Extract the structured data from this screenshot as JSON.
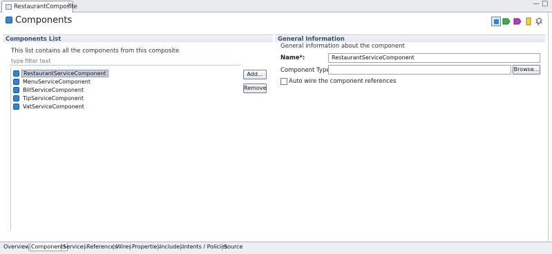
{
  "editor_tab": {
    "label": "RestaurantComposite",
    "close_glyph": "✕"
  },
  "window_controls": {
    "minimize": "—",
    "maximize": "□"
  },
  "header": {
    "title": "Components",
    "icon": "component-icon"
  },
  "toolbar": [
    {
      "name": "component-toolbar-icon",
      "color": "#2e86d6",
      "active": true
    },
    {
      "name": "service-toolbar-icon",
      "color": "#3cb043"
    },
    {
      "name": "reference-toolbar-icon",
      "color": "#b040c0"
    },
    {
      "name": "property-toolbar-icon",
      "color": "#e8c000"
    },
    {
      "name": "pin-toolbar-icon",
      "color": "#555555"
    }
  ],
  "components_list": {
    "section_title": "Components List",
    "description": "This list contains all the components from this composite",
    "filter_placeholder": "type filter text",
    "items": [
      {
        "label": "RestaurantServiceComponent",
        "selected": true
      },
      {
        "label": "MenuServiceComponent"
      },
      {
        "label": "BillServiceComponent"
      },
      {
        "label": "TipServiceComponent"
      },
      {
        "label": "VatServiceComponent"
      }
    ],
    "add_label": "Add...",
    "remove_label": "Remove"
  },
  "general_info": {
    "section_title": "General Information",
    "description": "General information about the component",
    "name_label": "Name*:",
    "name_value": "RestaurantServiceComponent",
    "type_label": "Component Type:",
    "type_value": "",
    "browse_label": "Browse...",
    "autowire_label": "Auto wire the component references"
  },
  "bottom_tabs": [
    {
      "label": "Overview"
    },
    {
      "label": "Components",
      "active": true
    },
    {
      "label": "Services"
    },
    {
      "label": "References"
    },
    {
      "label": "Wires"
    },
    {
      "label": "Properties"
    },
    {
      "label": "Includes"
    },
    {
      "label": "Intents / Policies"
    },
    {
      "label": "Source"
    }
  ]
}
